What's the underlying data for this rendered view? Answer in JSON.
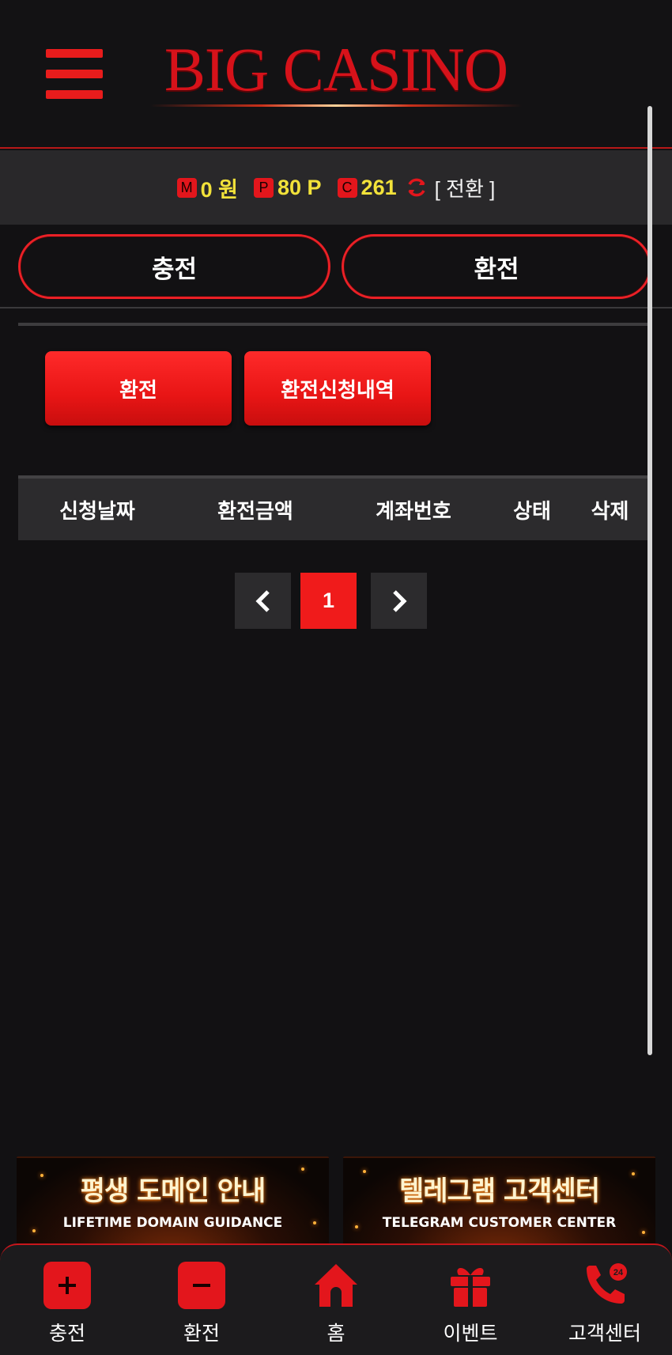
{
  "header": {
    "logo_text": "BIG CASINO"
  },
  "balance": {
    "money_badge": "M",
    "money_value": "0 원",
    "point_badge": "P",
    "point_value": "80 P",
    "casino_badge": "C",
    "casino_value": "261",
    "convert_label": "[ 전환 ]"
  },
  "tabs": {
    "charge": "충전",
    "exchange": "환전"
  },
  "actions": {
    "exchange": "환전",
    "history": "환전신청내역"
  },
  "table": {
    "columns": [
      "신청날짜",
      "환전금액",
      "계좌번호",
      "상태",
      "삭제"
    ]
  },
  "pagination": {
    "current_page": "1"
  },
  "banners": [
    {
      "title": "평생 도메인 안내",
      "subtitle": "LIFETIME DOMAIN GUIDANCE"
    },
    {
      "title": "텔레그램 고객센터",
      "subtitle": "TELEGRAM CUSTOMER CENTER"
    }
  ],
  "bottom_nav": [
    {
      "label": "충전",
      "icon": "plus-icon"
    },
    {
      "label": "환전",
      "icon": "minus-icon"
    },
    {
      "label": "홈",
      "icon": "home-icon"
    },
    {
      "label": "이벤트",
      "icon": "gift-icon"
    },
    {
      "label": "고객센터",
      "icon": "phone-24-icon"
    }
  ],
  "colors": {
    "accent": "#e3161c",
    "balance_text": "#f2e23a",
    "background": "#121113"
  }
}
